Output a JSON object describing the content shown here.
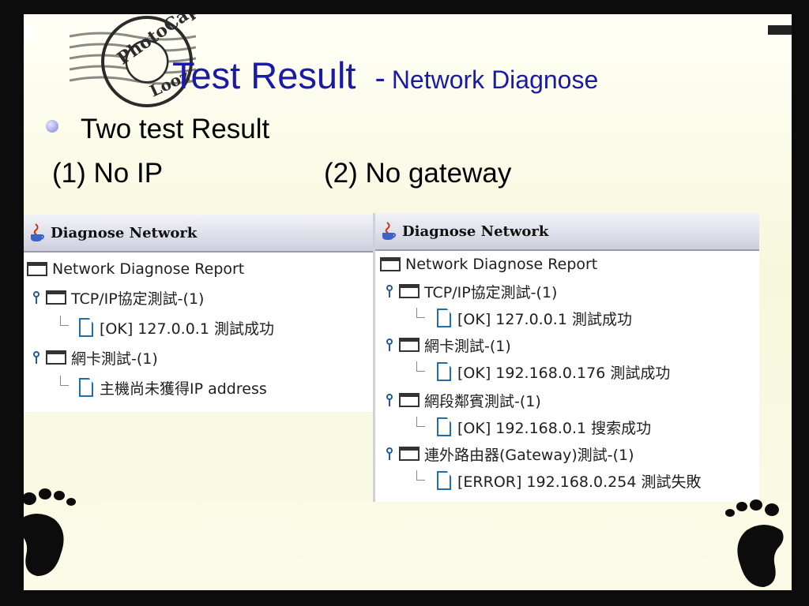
{
  "stamp": {
    "line1": "PhotoCap",
    "line2": "Looz"
  },
  "title": {
    "main": "Test Result",
    "dash": "-",
    "sub": "Network Diagnose"
  },
  "bullet": {
    "text": "Two test Result"
  },
  "cases": {
    "left": "(1) No IP",
    "right": "(2) No gateway"
  },
  "left_window": {
    "title": "Diagnose Network",
    "root": "Network Diagnose Report",
    "groups": [
      {
        "label": "TCP/IP協定測試-(1)",
        "child": "[OK] 127.0.0.1 測試成功"
      },
      {
        "label": "網卡測試-(1)",
        "child": "主機尚未獲得IP address"
      }
    ]
  },
  "right_window": {
    "title": "Diagnose Network",
    "root": "Network Diagnose Report",
    "groups": [
      {
        "label": "TCP/IP協定測試-(1)",
        "child": "[OK] 127.0.0.1 測試成功"
      },
      {
        "label": "網卡測試-(1)",
        "child": "[OK] 192.168.0.176 測試成功"
      },
      {
        "label": "網段鄰賓測試-(1)",
        "child": "[OK] 192.168.0.1 搜索成功"
      },
      {
        "label": "連外路由器(Gateway)測試-(1)",
        "child": "[ERROR] 192.168.0.254 測試失敗"
      }
    ]
  },
  "colors": {
    "title": "#1a1aa8",
    "frame": "#0c0c0c",
    "slide_bg": "#fcfcf1",
    "tree_icon": "#245a9a"
  },
  "icons": [
    "java-cup-icon",
    "folder-icon",
    "document-icon",
    "tree-key-icon",
    "footprint-icon"
  ]
}
